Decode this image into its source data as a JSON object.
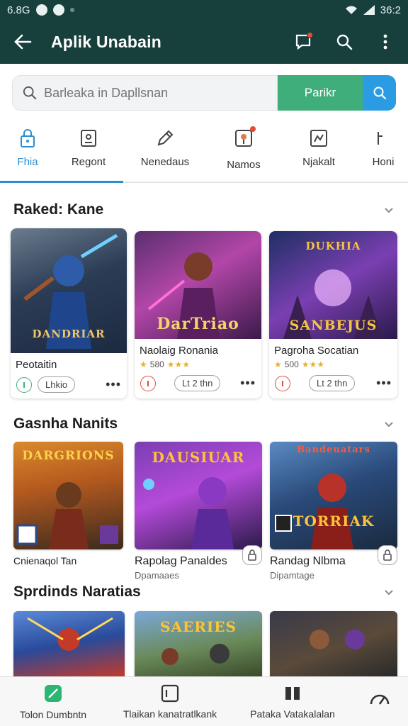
{
  "status": {
    "time": "6.8G",
    "battery": "36:2"
  },
  "appbar": {
    "title": "Aplik Unabain"
  },
  "search": {
    "placeholder": "Barleaka in Dapllsnan",
    "button_label": "Parikr"
  },
  "tabs": [
    {
      "label": "Fhia",
      "icon": "lock-icon",
      "active": true
    },
    {
      "label": "Regont",
      "icon": "device-icon"
    },
    {
      "label": "Nenedaus",
      "icon": "pencil-icon"
    },
    {
      "label": "Namos",
      "icon": "map-icon"
    },
    {
      "label": "Njakalt",
      "icon": "puzzle-icon"
    },
    {
      "label": "Honi",
      "icon": "slider-icon"
    }
  ],
  "sections": [
    {
      "title": "Raked: Kane"
    },
    {
      "title": "Gasnha Nanits"
    },
    {
      "title": "Sprdinds Naratias"
    }
  ],
  "ranked": [
    {
      "name": "Peotaitin",
      "rating": "",
      "button": "Lhkio",
      "art_text": "DANDRIAR"
    },
    {
      "name": "Naolaig Ronania",
      "rating": "580",
      "button": "Lt 2 thn",
      "art_text": "DarTriao"
    },
    {
      "name": "Pagroha Socatian",
      "rating": "500",
      "button": "Lt 2 thn",
      "art_text": "SANBEJUS"
    }
  ],
  "featured": [
    {
      "name": "Cnienaqol Tan",
      "sub": "",
      "art_text": "DARGRIONS"
    },
    {
      "name": "Rapolag Panaldes",
      "sub": "Dpamaaes",
      "art_text": "DAUSIUAR"
    },
    {
      "name": "Randag Nlbma",
      "sub": "Dipamtage",
      "art_text": "TORRIAK"
    }
  ],
  "special": [
    {
      "art_text": ""
    },
    {
      "art_text": "SAERIES"
    },
    {
      "art_text": ""
    }
  ],
  "bottom_nav": [
    {
      "label": "Tolon Dumbntn",
      "icon": "leaf-icon"
    },
    {
      "label": "Tlaikan kanatratlkank",
      "icon": "square-icon"
    },
    {
      "label": "Pataka Vatakalalan",
      "icon": "grid-icon"
    },
    {
      "label": "",
      "icon": "speed-icon"
    }
  ],
  "colors": {
    "appbar": "#173f3c",
    "accent": "#2a8fd0",
    "search_green": "#3fae7a",
    "search_blue": "#2b9be3"
  }
}
